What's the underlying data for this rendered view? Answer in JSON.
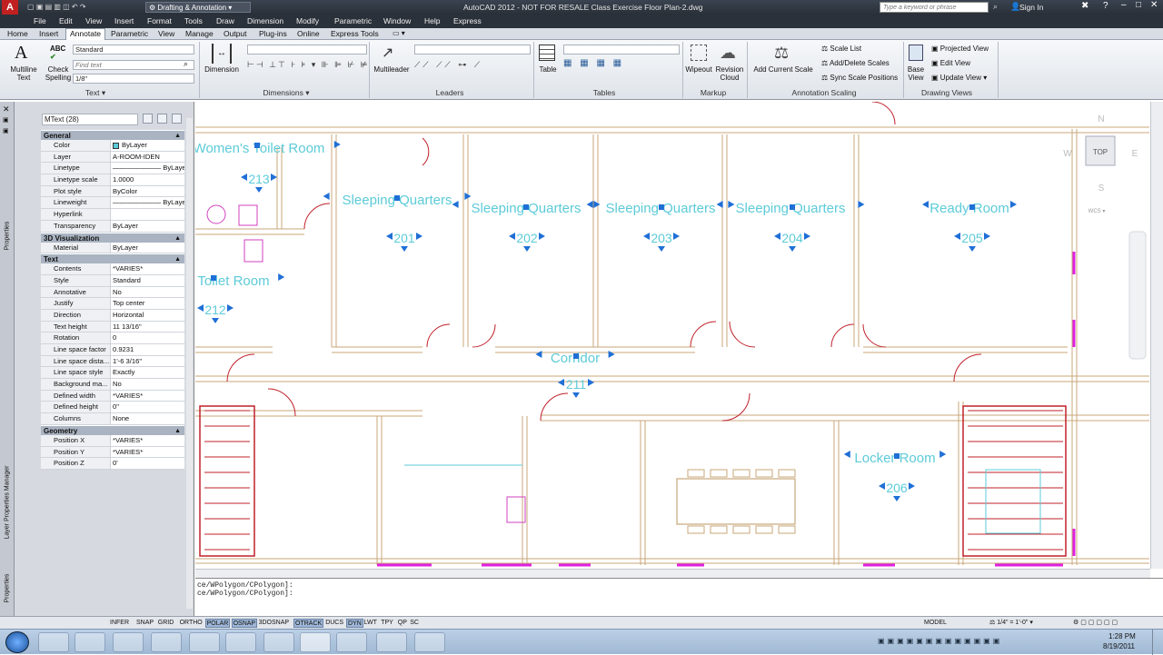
{
  "window": {
    "workspace": "Drafting & Annotation",
    "title": "AutoCAD 2012 - NOT FOR RESALE   Class Exercise Floor Plan-2.dwg",
    "search_placeholder": "Type a keyword or phrase",
    "sign_in": "Sign In"
  },
  "menu": [
    "File",
    "Edit",
    "View",
    "Insert",
    "Format",
    "Tools",
    "Draw",
    "Dimension",
    "Modify",
    "Parametric",
    "Window",
    "Help",
    "Express"
  ],
  "ribbon_tabs": [
    "Home",
    "Insert",
    "Annotate",
    "Parametric",
    "View",
    "Manage",
    "Output",
    "Plug-ins",
    "Online",
    "Express Tools"
  ],
  "active_tab": "Annotate",
  "ribbon": {
    "text_panel": {
      "multiline": "Multiline\nText",
      "check": "Check\nSpelling",
      "style": "Standard",
      "find_placeholder": "Find text",
      "height": "1/8\"",
      "label": "Text"
    },
    "dimensions_panel": {
      "dimension": "Dimension",
      "label": "Dimensions"
    },
    "leaders_panel": {
      "multileader": "Multileader",
      "label": "Leaders"
    },
    "tables_panel": {
      "table": "Table",
      "label": "Tables"
    },
    "markup_panel": {
      "wipeout": "Wipeout",
      "revision": "Revision\nCloud",
      "label": "Markup"
    },
    "scaling_panel": {
      "add_scale": "Add Current Scale",
      "scale_list": "Scale List",
      "add_delete": "Add/Delete Scales",
      "sync": "Sync Scale Positions",
      "label": "Annotation Scaling"
    },
    "views_panel": {
      "base": "Base\nView",
      "projected": "Projected View",
      "edit": "Edit View",
      "update": "Update View",
      "label": "Drawing Views"
    }
  },
  "properties": {
    "selector": "MText (28)",
    "sections": [
      {
        "title": "General",
        "rows": [
          {
            "k": "Color",
            "v": "ByLayer"
          },
          {
            "k": "Layer",
            "v": "A-ROOM-IDEN"
          },
          {
            "k": "Linetype",
            "v": "——————— ByLayer"
          },
          {
            "k": "Linetype scale",
            "v": "1.0000"
          },
          {
            "k": "Plot style",
            "v": "ByColor"
          },
          {
            "k": "Lineweight",
            "v": "——————— ByLayer"
          },
          {
            "k": "Hyperlink",
            "v": ""
          },
          {
            "k": "Transparency",
            "v": "ByLayer"
          }
        ]
      },
      {
        "title": "3D Visualization",
        "rows": [
          {
            "k": "Material",
            "v": "ByLayer"
          }
        ]
      },
      {
        "title": "Text",
        "rows": [
          {
            "k": "Contents",
            "v": "*VARIES*"
          },
          {
            "k": "Style",
            "v": "Standard"
          },
          {
            "k": "Annotative",
            "v": "No"
          },
          {
            "k": "Justify",
            "v": "Top center"
          },
          {
            "k": "Direction",
            "v": "Horizontal"
          },
          {
            "k": "Text height",
            "v": "11 13/16\""
          },
          {
            "k": "Rotation",
            "v": "0"
          },
          {
            "k": "Line space factor",
            "v": "0.9231"
          },
          {
            "k": "Line space dista...",
            "v": "1'-6 3/16\""
          },
          {
            "k": "Line space style",
            "v": "Exactly"
          },
          {
            "k": "Background ma...",
            "v": "No"
          },
          {
            "k": "Defined width",
            "v": "*VARIES*"
          },
          {
            "k": "Defined height",
            "v": "0\""
          },
          {
            "k": "Columns",
            "v": "None"
          }
        ]
      },
      {
        "title": "Geometry",
        "rows": [
          {
            "k": "Position X",
            "v": "*VARIES*"
          },
          {
            "k": "Position Y",
            "v": "*VARIES*"
          },
          {
            "k": "Position Z",
            "v": "0'"
          }
        ]
      }
    ],
    "side_labels": [
      "Properties",
      "Layer Properties Manager",
      "Properties"
    ]
  },
  "rooms": [
    {
      "name": "Women's Toilet Room",
      "num": "213"
    },
    {
      "name": "Toilet Room",
      "num": "212"
    },
    {
      "name": "Sleeping Quarters",
      "num": "201"
    },
    {
      "name": "Sleeping Quarters",
      "num": "202"
    },
    {
      "name": "Sleeping Quarters",
      "num": "203"
    },
    {
      "name": "Sleeping Quarters",
      "num": "204"
    },
    {
      "name": "Ready Room",
      "num": "205"
    },
    {
      "name": "Corridor",
      "num": "211"
    },
    {
      "name": "Locker Room",
      "num": "206"
    }
  ],
  "viewcube": {
    "n": "N",
    "s": "S",
    "e": "E",
    "w": "W",
    "top": "TOP",
    "wcs": "WCS"
  },
  "command_lines": [
    "ce/WPolygon/CPolygon]:",
    "ce/WPolygon/CPolygon]:"
  ],
  "status_toggles": [
    "INFER",
    "SNAP",
    "GRID",
    "ORTHO",
    "POLAR",
    "OSNAP",
    "3DOSNAP",
    "OTRACK",
    "DUCS",
    "DYN",
    "LWT",
    "TPY",
    "QP",
    "SC"
  ],
  "status_on": [
    "POLAR",
    "OSNAP",
    "OTRACK",
    "DYN"
  ],
  "status_right": {
    "model": "MODEL",
    "scale": "1/4\" = 1'-0\""
  },
  "clock": {
    "time": "1:28 PM",
    "date": "8/19/2011"
  },
  "colors": {
    "room_text": "#5ccbd8",
    "grip": "#1f6fd6",
    "wall": "#c8a77a",
    "door": "#c0202a",
    "fixture": "#d040c0"
  }
}
